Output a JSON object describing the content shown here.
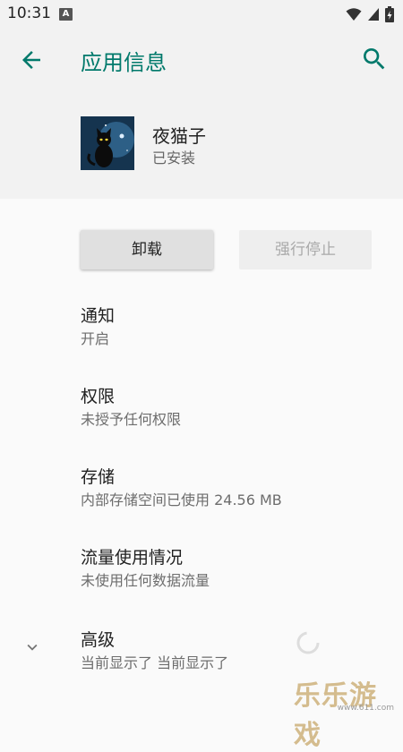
{
  "status_bar": {
    "time": "10:31",
    "notification_letter": "A"
  },
  "header": {
    "title": "应用信息"
  },
  "app": {
    "name": "夜猫子",
    "status": "已安装"
  },
  "buttons": {
    "uninstall": "卸载",
    "force_stop": "强行停止"
  },
  "settings": [
    {
      "title": "通知",
      "summary": "开启"
    },
    {
      "title": "权限",
      "summary": "未授予任何权限"
    },
    {
      "title": "存储",
      "summary": "内部存储空间已使用 24.56 MB"
    },
    {
      "title": "流量使用情况",
      "summary": "未使用任何数据流量"
    },
    {
      "title": "高级",
      "summary": "当前显示了 当前显示了"
    }
  ],
  "watermark": {
    "text": "乐乐游戏",
    "url": "www.611.com"
  },
  "colors": {
    "accent": "#00796b",
    "header_bg": "#f2f2f2",
    "body_bg": "#fafafa"
  }
}
